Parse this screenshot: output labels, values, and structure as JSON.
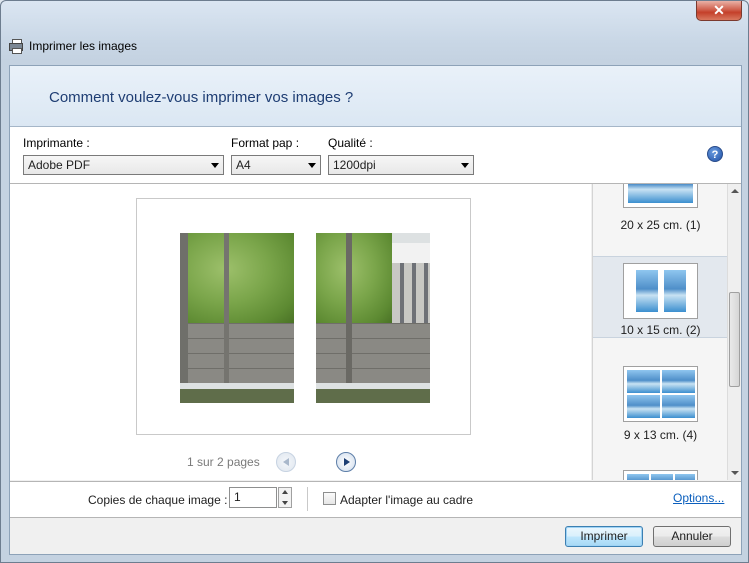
{
  "window": {
    "title": "Imprimer les images",
    "close_glyph": "✕",
    "icon": "printer-icon"
  },
  "header": {
    "title": "Comment voulez-vous imprimer vos images ?"
  },
  "settings": {
    "printer": {
      "label": "Imprimante :",
      "value": "Adobe PDF"
    },
    "paper_format": {
      "label": "Format pap :",
      "value": "A4"
    },
    "quality": {
      "label": "Qualité :",
      "value": "1200dpi"
    },
    "help_glyph": "?"
  },
  "preview": {
    "pager_text": "1 sur 2 pages",
    "prev_disabled": true
  },
  "layouts": {
    "items": [
      {
        "caption": "20 x 25 cm. (1)"
      },
      {
        "caption": "10 x 15 cm. (2)",
        "selected": true
      },
      {
        "caption": "9 x 13 cm. (4)"
      },
      {
        "caption": ""
      }
    ]
  },
  "options": {
    "copies_label": "Copies de chaque image :",
    "copies_value": "1",
    "fit_label": "Adapter l'image au cadre",
    "fit_checked": false,
    "options_link": "Options..."
  },
  "buttons": {
    "print": "Imprimer",
    "cancel": "Annuler"
  }
}
